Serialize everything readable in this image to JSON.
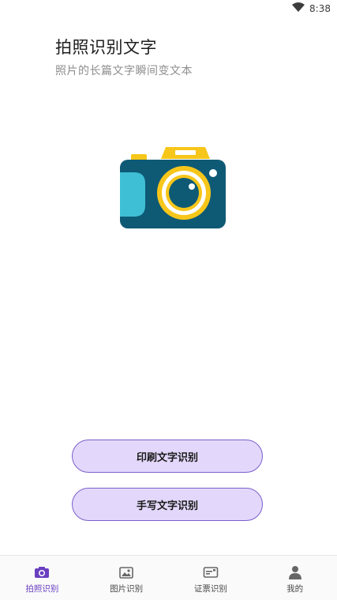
{
  "status": {
    "time": "8:38",
    "wifi_icon": "wifi-icon"
  },
  "header": {
    "title": "拍照识别文字",
    "subtitle": "照片的长篇文字瞬间变文本"
  },
  "illustration": {
    "icon": "camera-icon"
  },
  "actions": {
    "print_label": "印刷文字识别",
    "handwriting_label": "手写文字识别"
  },
  "nav": {
    "items": [
      {
        "label": "拍照识别",
        "icon": "camera-tab-icon",
        "active": true
      },
      {
        "label": "图片识别",
        "icon": "image-tab-icon",
        "active": false
      },
      {
        "label": "证票识别",
        "icon": "id-card-tab-icon",
        "active": false
      },
      {
        "label": "我的",
        "icon": "person-tab-icon",
        "active": false
      }
    ]
  },
  "colors": {
    "accent": "#6a3fc1",
    "button_bg": "#e3d8fb",
    "camera_body": "#0e5a75",
    "camera_yellow": "#f7c61a",
    "camera_side": "#3fbfd6"
  }
}
